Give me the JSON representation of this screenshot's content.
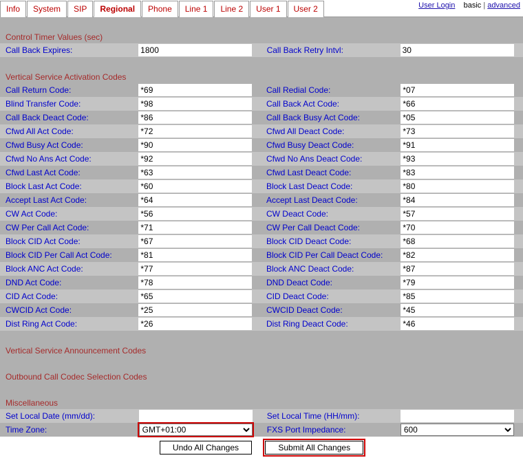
{
  "topright": {
    "user_login": "User Login",
    "basic": "basic",
    "advanced": "advanced"
  },
  "tabs": [
    "Info",
    "System",
    "SIP",
    "Regional",
    "Phone",
    "Line 1",
    "Line 2",
    "User 1",
    "User 2"
  ],
  "active_tab": 3,
  "sections": {
    "control_title": "Control Timer Values (sec)",
    "control_rows": [
      [
        {
          "label": "Call Back Expires:",
          "value": "1800",
          "type": "text",
          "name": "call-back-expires"
        },
        {
          "label": "Call Back Retry Intvl:",
          "value": "30",
          "type": "text",
          "name": "call-back-retry-intvl"
        }
      ]
    ],
    "vsac_title": "Vertical Service Activation Codes",
    "vsac_rows": [
      [
        {
          "label": "Call Return Code:",
          "value": "*69",
          "name": "call-return-code"
        },
        {
          "label": "Call Redial Code:",
          "value": "*07",
          "name": "call-redial-code"
        }
      ],
      [
        {
          "label": "Blind Transfer Code:",
          "value": "*98",
          "name": "blind-transfer-code"
        },
        {
          "label": "Call Back Act Code:",
          "value": "*66",
          "name": "call-back-act-code"
        }
      ],
      [
        {
          "label": "Call Back Deact Code:",
          "value": "*86",
          "name": "call-back-deact-code"
        },
        {
          "label": "Call Back Busy Act Code:",
          "value": "*05",
          "name": "call-back-busy-act-code"
        }
      ],
      [
        {
          "label": "Cfwd All Act Code:",
          "value": "*72",
          "name": "cfwd-all-act-code"
        },
        {
          "label": "Cfwd All Deact Code:",
          "value": "*73",
          "name": "cfwd-all-deact-code"
        }
      ],
      [
        {
          "label": "Cfwd Busy Act Code:",
          "value": "*90",
          "name": "cfwd-busy-act-code"
        },
        {
          "label": "Cfwd Busy Deact Code:",
          "value": "*91",
          "name": "cfwd-busy-deact-code"
        }
      ],
      [
        {
          "label": "Cfwd No Ans Act Code:",
          "value": "*92",
          "name": "cfwd-no-ans-act-code"
        },
        {
          "label": "Cfwd No Ans Deact Code:",
          "value": "*93",
          "name": "cfwd-no-ans-deact-code"
        }
      ],
      [
        {
          "label": "Cfwd Last Act Code:",
          "value": "*63",
          "name": "cfwd-last-act-code"
        },
        {
          "label": "Cfwd Last Deact Code:",
          "value": "*83",
          "name": "cfwd-last-deact-code"
        }
      ],
      [
        {
          "label": "Block Last Act Code:",
          "value": "*60",
          "name": "block-last-act-code"
        },
        {
          "label": "Block Last Deact Code:",
          "value": "*80",
          "name": "block-last-deact-code"
        }
      ],
      [
        {
          "label": "Accept Last Act Code:",
          "value": "*64",
          "name": "accept-last-act-code"
        },
        {
          "label": "Accept Last Deact Code:",
          "value": "*84",
          "name": "accept-last-deact-code"
        }
      ],
      [
        {
          "label": "CW Act Code:",
          "value": "*56",
          "name": "cw-act-code"
        },
        {
          "label": "CW Deact Code:",
          "value": "*57",
          "name": "cw-deact-code"
        }
      ],
      [
        {
          "label": "CW Per Call Act Code:",
          "value": "*71",
          "name": "cw-per-call-act-code"
        },
        {
          "label": "CW Per Call Deact Code:",
          "value": "*70",
          "name": "cw-per-call-deact-code"
        }
      ],
      [
        {
          "label": "Block CID Act Code:",
          "value": "*67",
          "name": "block-cid-act-code"
        },
        {
          "label": "Block CID Deact Code:",
          "value": "*68",
          "name": "block-cid-deact-code"
        }
      ],
      [
        {
          "label": "Block CID Per Call Act Code:",
          "value": "*81",
          "name": "block-cid-per-call-act-code"
        },
        {
          "label": "Block CID Per Call Deact Code:",
          "value": "*82",
          "name": "block-cid-per-call-deact-code"
        }
      ],
      [
        {
          "label": "Block ANC Act Code:",
          "value": "*77",
          "name": "block-anc-act-code"
        },
        {
          "label": "Block ANC Deact Code:",
          "value": "*87",
          "name": "block-anc-deact-code"
        }
      ],
      [
        {
          "label": "DND Act Code:",
          "value": "*78",
          "name": "dnd-act-code"
        },
        {
          "label": "DND Deact Code:",
          "value": "*79",
          "name": "dnd-deact-code"
        }
      ],
      [
        {
          "label": "CID Act Code:",
          "value": "*65",
          "name": "cid-act-code"
        },
        {
          "label": "CID Deact Code:",
          "value": "*85",
          "name": "cid-deact-code"
        }
      ],
      [
        {
          "label": "CWCID Act Code:",
          "value": "*25",
          "name": "cwcid-act-code"
        },
        {
          "label": "CWCID Deact Code:",
          "value": "*45",
          "name": "cwcid-deact-code"
        }
      ],
      [
        {
          "label": "Dist Ring Act Code:",
          "value": "*26",
          "name": "dist-ring-act-code"
        },
        {
          "label": "Dist Ring Deact Code:",
          "value": "*46",
          "name": "dist-ring-deact-code"
        }
      ]
    ],
    "announce_title": "Vertical Service Announcement Codes",
    "outbound_title": "Outbound Call Codec Selection Codes",
    "misc_title": "Miscellaneous",
    "misc_rows": [
      [
        {
          "label": "Set Local Date (mm/dd):",
          "value": "",
          "type": "text",
          "name": "set-local-date"
        },
        {
          "label": "Set Local Time (HH/mm):",
          "value": "",
          "type": "text",
          "name": "set-local-time"
        }
      ],
      [
        {
          "label": "Time Zone:",
          "value": "GMT+01:00",
          "type": "select",
          "name": "time-zone",
          "highlight": true
        },
        {
          "label": "FXS Port Impedance:",
          "value": "600",
          "type": "select",
          "name": "fxs-port-impedance"
        }
      ]
    ]
  },
  "buttons": {
    "undo": "Undo All Changes",
    "submit": "Submit All Changes"
  }
}
